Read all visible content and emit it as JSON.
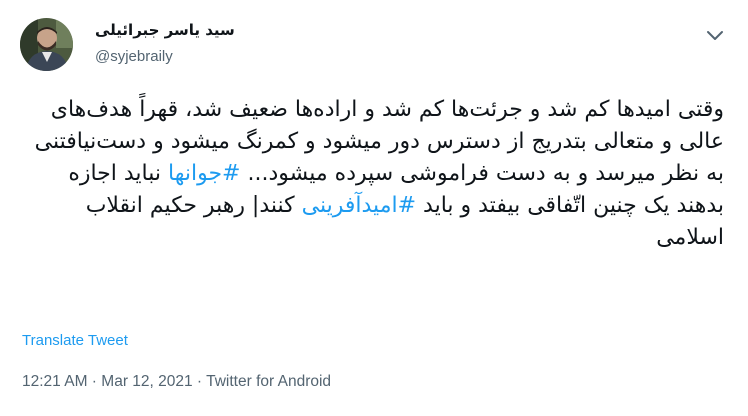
{
  "user": {
    "display_name": "سید یاسر جبرائیلی",
    "handle": "@syjebraily",
    "avatar_icon": "profile-photo"
  },
  "header": {
    "more_icon": "chevron-down-icon"
  },
  "tweet": {
    "segments": {
      "s1": "وقتی امیدها کم شد و جرئت‌ها کم شد و اراده‌ها ضعیف شد، قهراً هدف‌های عالی و متعالی بتدریج از دسترس دور میشود و کمرنگ میشود و دست‌نیافتنی به نظر میرسد و به دست فراموشی سپرده میشود... ",
      "hashtag1": "#جوانها",
      "s2": " نباید اجازه بدهند یک چنین اتّفاقی بیفتد و باید ",
      "hashtag2": "#امیدآفرینی",
      "s3": " کنند| رهبر حکیم انقلاب اسلامی"
    }
  },
  "translate_label": "Translate Tweet",
  "meta": {
    "time": "12:21 AM",
    "separator": " · ",
    "date": "Mar 12, 2021",
    "source": "Twitter for Android"
  },
  "colors": {
    "link": "#1d9bf0",
    "text": "#0f1419",
    "secondary": "#536471"
  }
}
